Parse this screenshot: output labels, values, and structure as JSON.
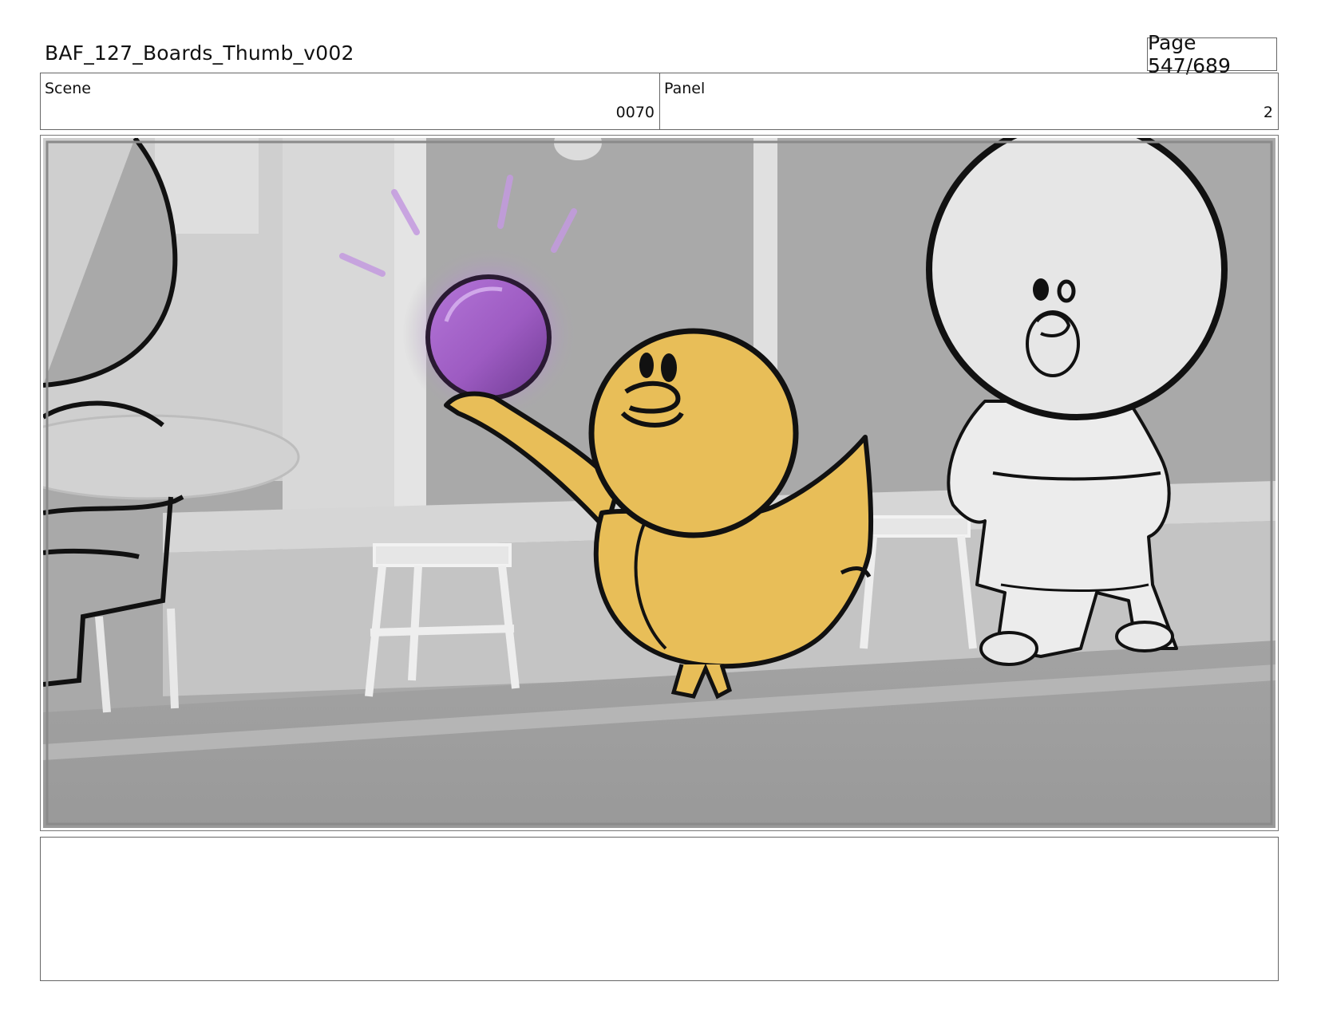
{
  "header": {
    "title": "BAF_127_Boards_Thumb_v002",
    "page_label": "Page 547/689"
  },
  "info": {
    "scene_label": "Scene",
    "scene_value": "0070",
    "panel_label": "Panel",
    "panel_value": "2"
  },
  "colors": {
    "duck_yellow": "#E8BE58",
    "orb_purple": "#9D5BC2",
    "background_gray": "#A9A9A9",
    "ink": "#111111"
  }
}
